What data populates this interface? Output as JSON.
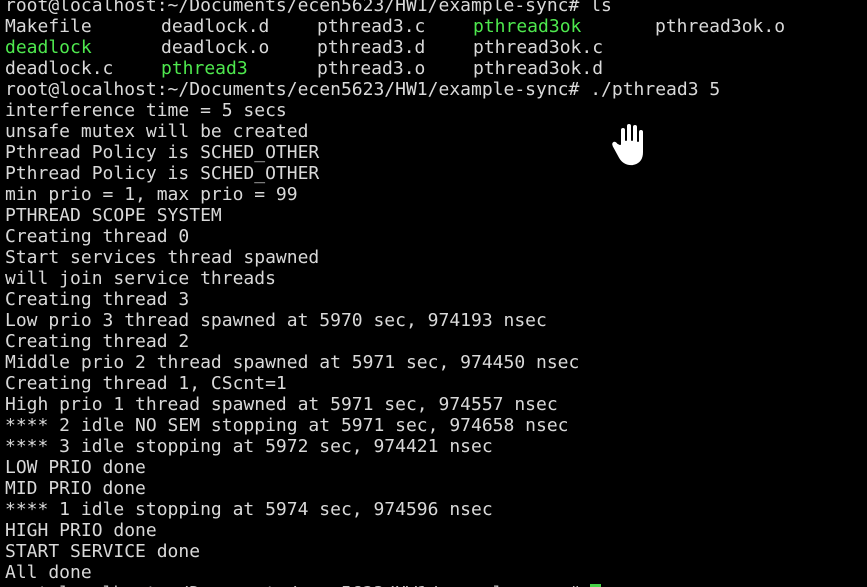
{
  "terminal": {
    "prompt": "root@localhost:~/Documents/ecen5623/HW1/example-sync#",
    "cmd_ls": "ls",
    "ls_rows": [
      [
        {
          "text": "Makefile",
          "exec": false
        },
        {
          "text": "deadlock.d",
          "exec": false
        },
        {
          "text": "pthread3.c",
          "exec": false
        },
        {
          "text": "pthread3ok",
          "exec": true
        },
        {
          "text": "pthread3ok.o",
          "exec": false
        }
      ],
      [
        {
          "text": "deadlock",
          "exec": true
        },
        {
          "text": "deadlock.o",
          "exec": false
        },
        {
          "text": "pthread3.d",
          "exec": false
        },
        {
          "text": "pthread3ok.c",
          "exec": false
        }
      ],
      [
        {
          "text": "deadlock.c",
          "exec": false
        },
        {
          "text": "pthread3",
          "exec": true
        },
        {
          "text": "pthread3.o",
          "exec": false
        },
        {
          "text": "pthread3ok.d",
          "exec": false
        }
      ]
    ],
    "cmd_run": "./pthread3 5",
    "output": [
      "interference time = 5 secs",
      "unsafe mutex will be created",
      "Pthread Policy is SCHED_OTHER",
      "Pthread Policy is SCHED_OTHER",
      "min prio = 1, max prio = 99",
      "PTHREAD SCOPE SYSTEM",
      "Creating thread 0",
      "Start services thread spawned",
      "will join service threads",
      "Creating thread 3",
      "Low prio 3 thread spawned at 5970 sec, 974193 nsec",
      "Creating thread 2",
      "Middle prio 2 thread spawned at 5971 sec, 974450 nsec",
      "Creating thread 1, CScnt=1",
      "High prio 1 thread spawned at 5971 sec, 974557 nsec",
      "**** 2 idle NO SEM stopping at 5971 sec, 974658 nsec",
      "**** 3 idle stopping at 5972 sec, 974421 nsec",
      "LOW PRIO done",
      "MID PRIO done",
      "**** 1 idle stopping at 5974 sec, 974596 nsec",
      "HIGH PRIO done",
      "START SERVICE done",
      "All done"
    ]
  },
  "icons": {
    "pointer": "hand-grab-cursor-icon"
  },
  "colors": {
    "background": "#000000",
    "text": "#d9d9d9",
    "executable": "#4ee84e",
    "cursor": "#4ee84e"
  }
}
